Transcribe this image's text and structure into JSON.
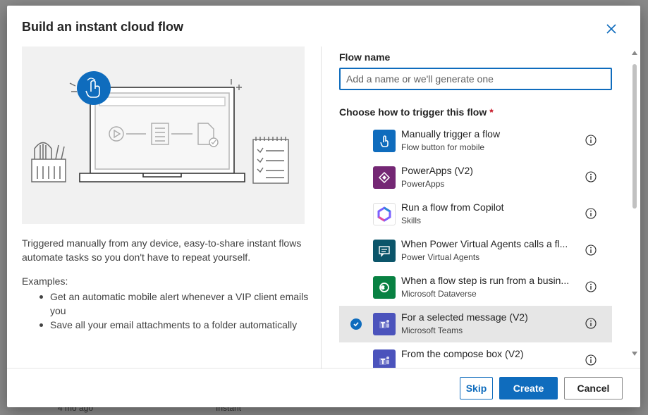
{
  "background": {
    "top_left": "",
    "top_right": "",
    "bottom_left": "4 mo ago",
    "bottom_right": "Instant"
  },
  "dialog": {
    "title": "Build an instant cloud flow",
    "close_icon": "close-icon"
  },
  "left_pane": {
    "description": "Triggered manually from any device, easy-to-share instant flows automate tasks so you don't have to repeat yourself.",
    "examples_label": "Examples:",
    "examples": [
      "Get an automatic mobile alert whenever a VIP client emails you",
      "Save all your email attachments to a folder automatically"
    ]
  },
  "flow_name": {
    "label": "Flow name",
    "value": "",
    "placeholder": "Add a name or we'll generate one"
  },
  "trigger": {
    "label": "Choose how to trigger this flow",
    "required_mark": "*",
    "items": [
      {
        "title": "Manually trigger a flow",
        "subtitle": "Flow button for mobile",
        "icon": "touch-icon",
        "color": "#0f6cbd",
        "selected": false
      },
      {
        "title": "PowerApps (V2)",
        "subtitle": "PowerApps",
        "icon": "powerapps-icon",
        "color": "#742774",
        "selected": false
      },
      {
        "title": "Run a flow from Copilot",
        "subtitle": "Skills",
        "icon": "copilot-icon",
        "color": "#ffffff",
        "selected": false
      },
      {
        "title": "When Power Virtual Agents calls a fl...",
        "subtitle": "Power Virtual Agents",
        "icon": "pva-icon",
        "color": "#0b556a",
        "selected": false
      },
      {
        "title": "When a flow step is run from a busin...",
        "subtitle": "Microsoft Dataverse",
        "icon": "dataverse-icon",
        "color": "#088142",
        "selected": false
      },
      {
        "title": "For a selected message (V2)",
        "subtitle": "Microsoft Teams",
        "icon": "teams-icon",
        "color": "#4b53bc",
        "selected": true
      },
      {
        "title": "From the compose box (V2)",
        "subtitle": "",
        "icon": "teams-icon",
        "color": "#4b53bc",
        "selected": false
      }
    ]
  },
  "footer": {
    "skip": "Skip",
    "create": "Create",
    "cancel": "Cancel"
  },
  "colors": {
    "accent": "#0f6cbd",
    "required": "#c50f1f",
    "selected_row": "#e6e6e6"
  }
}
